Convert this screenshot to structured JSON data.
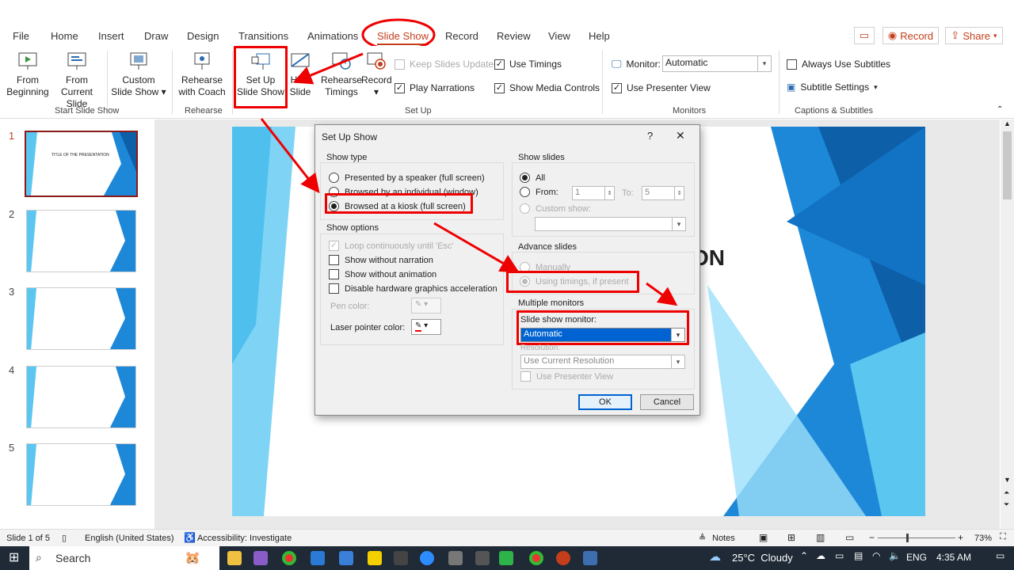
{
  "menu": {
    "items": [
      "File",
      "Home",
      "Insert",
      "Draw",
      "Design",
      "Transitions",
      "Animations",
      "Slide Show",
      "Record",
      "Review",
      "View",
      "Help"
    ],
    "record_btn": "Record",
    "share_btn": "Share"
  },
  "ribbon": {
    "from_beginning": "From Beginning",
    "from_current": "From Current Slide",
    "custom_show": "Custom Slide Show",
    "group_start": "Start Slide Show",
    "rehearse_coach": "Rehearse with Coach",
    "group_rehearse": "Rehearse",
    "setup_show": "Set Up Slide Show",
    "hide_slide": "Hide Slide",
    "rehearse_timings": "Rehearse Timings",
    "record": "Record",
    "keep_slides_updated": "Keep Slides Updated",
    "play_narrations": "Play Narrations",
    "use_timings": "Use Timings",
    "show_media_controls": "Show Media Controls",
    "group_setup": "Set Up",
    "monitor_label": "Monitor:",
    "monitor_value": "Automatic",
    "use_presenter_view": "Use Presenter View",
    "group_monitors": "Monitors",
    "always_use_subtitles": "Always Use Subtitles",
    "subtitle_settings": "Subtitle Settings",
    "group_captions": "Captions & Subtitles"
  },
  "slides": {
    "numbers": [
      "1",
      "2",
      "3",
      "4",
      "5"
    ],
    "thumb1_title": "TITLE OF THE PRESENTATION",
    "main_title_fragment": "ON"
  },
  "dialog": {
    "title": "Set Up Show",
    "help": "?",
    "close": "✕",
    "show_type": {
      "legend": "Show type",
      "opt1": "Presented by a speaker (full screen)",
      "opt2": "Browsed by an individual (window)",
      "opt3": "Browsed at a kiosk (full screen)"
    },
    "show_options": {
      "legend": "Show options",
      "loop": "Loop continuously until 'Esc'",
      "no_narration": "Show without narration",
      "no_animation": "Show without animation",
      "disable_hw": "Disable hardware graphics acceleration",
      "pen_color": "Pen color:",
      "laser_color": "Laser pointer color:"
    },
    "show_slides": {
      "legend": "Show slides",
      "all": "All",
      "from": "From:",
      "from_value": "1",
      "to": "To:",
      "to_value": "5",
      "custom_show": "Custom show:"
    },
    "advance": {
      "legend": "Advance slides",
      "manually": "Manually",
      "timings": "Using timings, if present"
    },
    "monitors": {
      "legend": "Multiple monitors",
      "slide_show_monitor": "Slide show monitor:",
      "monitor_value": "Automatic",
      "resolution": "Resolution:",
      "resolution_value": "Use Current Resolution",
      "presenter_view": "Use Presenter View"
    },
    "ok": "OK",
    "cancel": "Cancel"
  },
  "status": {
    "slide_count": "Slide 1 of 5",
    "language": "English (United States)",
    "accessibility": "Accessibility: Investigate",
    "notes": "Notes",
    "zoom": "73%"
  },
  "taskbar": {
    "search": "Search",
    "weather": "25°C  Cloudy",
    "lang": "ENG",
    "time": "4:35 AM"
  },
  "colors": {
    "accent_red": "#c43e1c",
    "annotation_red": "#ee0000",
    "slide_blue": "#1e88d8",
    "taskbar": "#1f2a36"
  }
}
